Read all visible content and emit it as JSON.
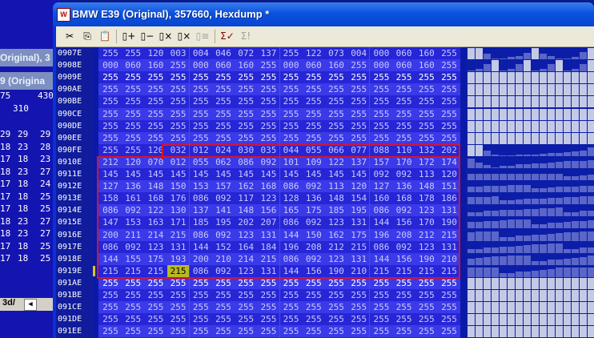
{
  "window": {
    "title": "BMW E39 (Original), 357660, Hexdump *"
  },
  "background_window": {
    "title_top": "Original), 3",
    "title_bottom": "9 (Origina",
    "row_a": [
      "75",
      "430"
    ],
    "row_b": "310",
    "rows": [
      [
        "29",
        "29",
        "29"
      ],
      [
        "18",
        "23",
        "28"
      ],
      [
        "17",
        "18",
        "23"
      ],
      [
        "18",
        "23",
        "27"
      ],
      [
        "17",
        "18",
        "24"
      ],
      [
        "17",
        "18",
        "25"
      ],
      [
        "17",
        "18",
        "25"
      ],
      [
        "18",
        "23",
        "27"
      ],
      [
        "18",
        "23",
        "27"
      ],
      [
        "17",
        "18",
        "25"
      ],
      [
        "17",
        "18",
        "25"
      ]
    ],
    "scroll_tab": "3d/"
  },
  "toolbar": {
    "cut": "✂",
    "copy": "⎘",
    "paste": "📋",
    "b1": "▯+",
    "b2": "▯−",
    "b3": "▯×",
    "b4": "▯×",
    "b5": "▯≡",
    "sum_check": "Σ✓",
    "sum": "Σ!"
  },
  "hexdump": {
    "rows": [
      {
        "addr": "0907E",
        "style": "dim",
        "v": [
          "255",
          "255",
          "120",
          "003",
          "004",
          "046",
          "072",
          "137",
          "255",
          "122",
          "073",
          "004",
          "000",
          "060",
          "160",
          "255"
        ]
      },
      {
        "addr": "0908E",
        "style": "dim",
        "v": [
          "000",
          "060",
          "160",
          "255",
          "000",
          "060",
          "160",
          "255",
          "000",
          "060",
          "160",
          "255",
          "000",
          "060",
          "160",
          "255"
        ]
      },
      {
        "addr": "0909E",
        "style": "white",
        "v": [
          "255",
          "255",
          "255",
          "255",
          "255",
          "255",
          "255",
          "255",
          "255",
          "255",
          "255",
          "255",
          "255",
          "255",
          "255",
          "255"
        ]
      },
      {
        "addr": "090AE",
        "style": "dim",
        "v": [
          "255",
          "255",
          "255",
          "255",
          "255",
          "255",
          "255",
          "255",
          "255",
          "255",
          "255",
          "255",
          "255",
          "255",
          "255",
          "255"
        ]
      },
      {
        "addr": "090BE",
        "style": "dim",
        "v": [
          "255",
          "255",
          "255",
          "255",
          "255",
          "255",
          "255",
          "255",
          "255",
          "255",
          "255",
          "255",
          "255",
          "255",
          "255",
          "255"
        ]
      },
      {
        "addr": "090CE",
        "style": "dim",
        "v": [
          "255",
          "255",
          "255",
          "255",
          "255",
          "255",
          "255",
          "255",
          "255",
          "255",
          "255",
          "255",
          "255",
          "255",
          "255",
          "255"
        ]
      },
      {
        "addr": "090DE",
        "style": "dim",
        "v": [
          "255",
          "255",
          "255",
          "255",
          "255",
          "255",
          "255",
          "255",
          "255",
          "255",
          "255",
          "255",
          "255",
          "255",
          "255",
          "255"
        ]
      },
      {
        "addr": "090EE",
        "style": "dim",
        "v": [
          "255",
          "255",
          "255",
          "255",
          "255",
          "255",
          "255",
          "255",
          "255",
          "255",
          "255",
          "255",
          "255",
          "255",
          "255",
          "255"
        ]
      },
      {
        "addr": "090FE",
        "style": "dim",
        "v": [
          "255",
          "255",
          "120",
          "032",
          "012",
          "024",
          "030",
          "035",
          "044",
          "055",
          "066",
          "077",
          "088",
          "110",
          "132",
          "202"
        ]
      },
      {
        "addr": "0910E",
        "style": "dim",
        "v": [
          "212",
          "120",
          "070",
          "012",
          "055",
          "062",
          "086",
          "092",
          "101",
          "109",
          "122",
          "137",
          "157",
          "170",
          "172",
          "174"
        ]
      },
      {
        "addr": "0911E",
        "style": "dim",
        "v": [
          "145",
          "145",
          "145",
          "145",
          "145",
          "145",
          "145",
          "145",
          "145",
          "145",
          "145",
          "145",
          "092",
          "092",
          "113",
          "120"
        ]
      },
      {
        "addr": "0912E",
        "style": "dim",
        "v": [
          "127",
          "136",
          "148",
          "150",
          "153",
          "157",
          "162",
          "168",
          "086",
          "092",
          "113",
          "120",
          "127",
          "136",
          "148",
          "151"
        ]
      },
      {
        "addr": "0913E",
        "style": "dim",
        "v": [
          "158",
          "161",
          "168",
          "176",
          "086",
          "092",
          "117",
          "123",
          "128",
          "136",
          "148",
          "154",
          "160",
          "168",
          "178",
          "186"
        ]
      },
      {
        "addr": "0914E",
        "style": "dim",
        "v": [
          "086",
          "092",
          "122",
          "130",
          "137",
          "141",
          "148",
          "156",
          "165",
          "175",
          "185",
          "195",
          "086",
          "092",
          "123",
          "131"
        ]
      },
      {
        "addr": "0915E",
        "style": "dim",
        "v": [
          "147",
          "153",
          "163",
          "171",
          "185",
          "195",
          "202",
          "207",
          "086",
          "092",
          "123",
          "131",
          "144",
          "156",
          "170",
          "190"
        ]
      },
      {
        "addr": "0916E",
        "style": "dim",
        "v": [
          "200",
          "211",
          "214",
          "215",
          "086",
          "092",
          "123",
          "131",
          "144",
          "150",
          "162",
          "175",
          "196",
          "208",
          "212",
          "215"
        ]
      },
      {
        "addr": "0917E",
        "style": "dim",
        "v": [
          "086",
          "092",
          "123",
          "131",
          "144",
          "152",
          "164",
          "184",
          "196",
          "208",
          "212",
          "215",
          "086",
          "092",
          "123",
          "131"
        ]
      },
      {
        "addr": "0918E",
        "style": "dim",
        "v": [
          "144",
          "155",
          "175",
          "193",
          "200",
          "210",
          "214",
          "215",
          "086",
          "092",
          "123",
          "131",
          "144",
          "156",
          "190",
          "210"
        ]
      },
      {
        "addr": "0919E",
        "style": "dim",
        "v": [
          "215",
          "215",
          "215",
          "215",
          "086",
          "092",
          "123",
          "131",
          "144",
          "156",
          "190",
          "210",
          "215",
          "215",
          "215",
          "215"
        ]
      },
      {
        "addr": "091AE",
        "style": "white",
        "v": [
          "255",
          "255",
          "255",
          "255",
          "255",
          "255",
          "255",
          "255",
          "255",
          "255",
          "255",
          "255",
          "255",
          "255",
          "255",
          "255"
        ]
      },
      {
        "addr": "091BE",
        "style": "dim",
        "v": [
          "255",
          "255",
          "255",
          "255",
          "255",
          "255",
          "255",
          "255",
          "255",
          "255",
          "255",
          "255",
          "255",
          "255",
          "255",
          "255"
        ]
      },
      {
        "addr": "091CE",
        "style": "dim",
        "v": [
          "255",
          "255",
          "255",
          "255",
          "255",
          "255",
          "255",
          "255",
          "255",
          "255",
          "255",
          "255",
          "255",
          "255",
          "255",
          "255"
        ]
      },
      {
        "addr": "091DE",
        "style": "dim",
        "v": [
          "255",
          "255",
          "255",
          "255",
          "255",
          "255",
          "255",
          "255",
          "255",
          "255",
          "255",
          "255",
          "255",
          "255",
          "255",
          "255"
        ]
      },
      {
        "addr": "091EE",
        "style": "dim",
        "v": [
          "255",
          "255",
          "255",
          "255",
          "255",
          "255",
          "255",
          "255",
          "255",
          "255",
          "255",
          "255",
          "255",
          "255",
          "255",
          "255"
        ]
      }
    ],
    "highlight": {
      "row": 18,
      "col": 3
    },
    "selection_color": "#e01020"
  },
  "colors": {
    "hex_bg": "#2626d6",
    "title_start": "#3b7dee",
    "title_end": "#0845d0"
  }
}
